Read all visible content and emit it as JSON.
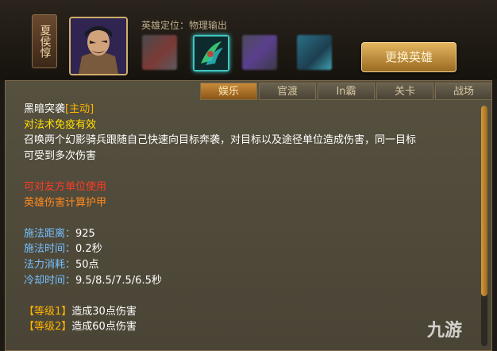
{
  "hero": {
    "name": "夏侯惇",
    "role_label": "英雄定位：物理输出"
  },
  "icons": {
    "portrait": "hero-portrait",
    "skills": [
      "skill-1-icon",
      "skill-2-icon",
      "skill-3-icon",
      "skill-4-icon"
    ]
  },
  "swap_button": "更换英雄",
  "tabs": [
    "娱乐",
    "官渡",
    "In霸",
    "关卡",
    "战场"
  ],
  "active_tab": "娱乐",
  "skill": {
    "name": "黑暗突袭",
    "type": "[主动]",
    "immune": "对法术免疫有效",
    "desc1": "召唤两个幻影骑兵跟随自己快速向目标奔袭，对目标以及途径单位造成伤害，同一目标",
    "desc2": "可受到多次伤害",
    "ally": "可对友方单位使用",
    "armor": "英雄伤害计算护甲",
    "stats": [
      {
        "label": "施法距离：",
        "value": "925"
      },
      {
        "label": "施法时间：",
        "value": "0.2秒"
      },
      {
        "label": "法力消耗：",
        "value": "50点"
      },
      {
        "label": "冷却时间：",
        "value": "9.5/8.5/7.5/6.5秒"
      }
    ],
    "levels": [
      {
        "label": "【等级1】",
        "text": "造成30点伤害"
      },
      {
        "label": "【等级2】",
        "text": "造成60点伤害"
      }
    ]
  },
  "watermark": "九游",
  "colors": {
    "accent": "#c98b3a",
    "skill_name": "#ffffff",
    "skill_type": "#ffb400",
    "immune": "#ffe000",
    "ally": "#ff3b24",
    "armor": "#ff8a1e",
    "stat_label": "#74c0ff"
  }
}
